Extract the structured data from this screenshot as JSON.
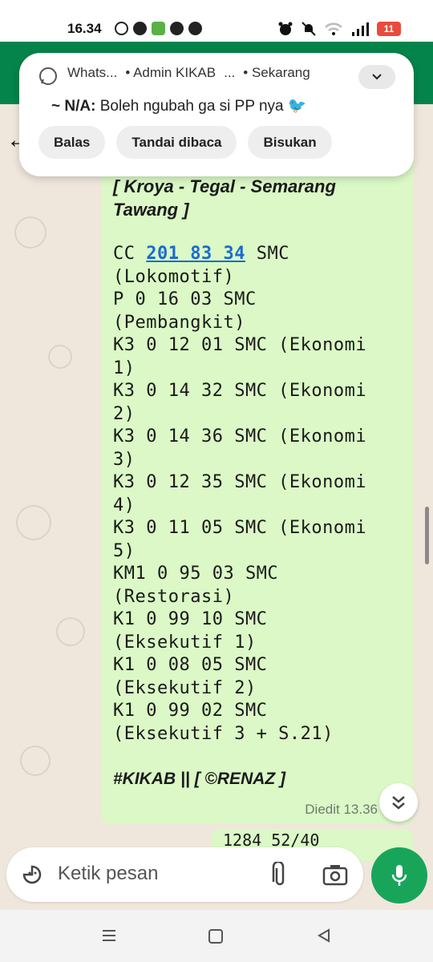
{
  "status_bar": {
    "time": "16.34",
    "battery": "11",
    "icons_left": [
      "whatsapp-icon",
      "app-icon",
      "app-icon",
      "facebook-icon",
      "chat-icon"
    ],
    "icons_right": [
      "alarm-icon",
      "mute-icon",
      "wifi-icon",
      "signal-icon",
      "battery-icon"
    ]
  },
  "notification": {
    "app": "Whats...",
    "group": "• Admin KIKAB",
    "group_suffix": "...",
    "time": "• Sekarang",
    "sender": "~ N/A:",
    "message": "Boleh ngubah ga si PP nya",
    "emoji": "🐦",
    "actions": [
      "Balas",
      "Tandai dibaca",
      "Bisukan"
    ]
  },
  "message": {
    "title": "[ Kroya - Tegal - Semarang Tawang ]",
    "lines_before_link": "CC ",
    "link": "201 83 34",
    "body": " SMC\n(Lokomotif)\nP 0 16 03 SMC\n(Pembangkit)\nK3 0 12 01 SMC (Ekonomi\n1)\nK3 0 14 32 SMC (Ekonomi\n2)\nK3 0 14 36 SMC (Ekonomi\n3)\nK3 0 12 35 SMC (Ekonomi\n4)\nK3 0 11 05 SMC (Ekonomi\n5)\nKM1 0 95 03 SMC\n(Restorasi)\nK1 0 99 10 SMC\n(Eksekutif 1)\nK1 0 08 05 SMC\n(Eksekutif 2)\nK1 0 99 02 SMC\n(Eksekutif 3 + S.21)",
    "tag": "#KIKAB || [ ©RENAZ ]",
    "meta": "Diedit 13.36"
  },
  "next_message": {
    "partial_text": "1284 52/40"
  },
  "input": {
    "placeholder": "Ketik pesan"
  },
  "colors": {
    "header_green": "#04844a",
    "bubble_green": "#dbf8c6",
    "mic_green": "#18a55a",
    "link_blue": "#1a6bd0",
    "chat_bg": "#efe7dc"
  }
}
